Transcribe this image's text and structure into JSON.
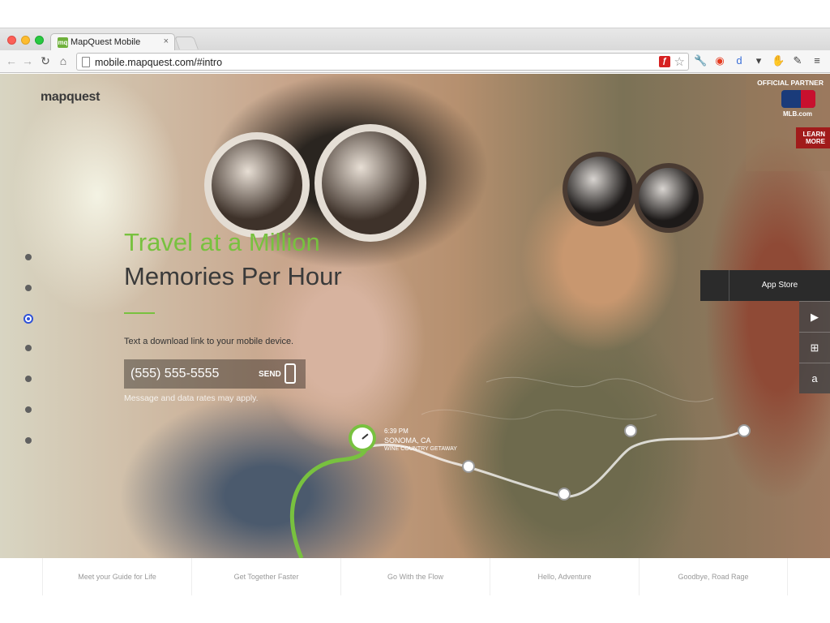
{
  "browser": {
    "tab_title": "MapQuest Mobile",
    "tab_favicon": "mq",
    "tab_close": "×",
    "url": "mobile.mapquest.com/#intro",
    "icons": [
      "back-icon",
      "forward-icon",
      "reload-icon",
      "home-icon",
      "flash-icon",
      "star-icon",
      "wrench-icon",
      "record-icon",
      "d-icon",
      "pocket-icon",
      "glove-icon",
      "tools-icon",
      "menu-icon"
    ]
  },
  "header": {
    "logo": "mapquest",
    "partner_label": "OFFICIAL PARTNER",
    "partner_logo": "MLB.com",
    "learn_more": "LEARN\nMORE"
  },
  "hero": {
    "headline_green": "Travel at a Million",
    "headline_dark": "Memories Per Hour",
    "prompt": "Text a download link to your mobile device.",
    "phone_value": "(555) 555-5555",
    "send_label": "SEND",
    "disclaimer": "Message and data rates may apply."
  },
  "pager": {
    "count": 7,
    "active_index": 2
  },
  "stores": {
    "app_store_label": "App Store",
    "items": [
      "apple-icon",
      "google-play-icon",
      "windows-icon",
      "amazon-icon"
    ]
  },
  "map_pin": {
    "time": "6:39 PM",
    "place": "SONOMA, CA",
    "subtitle": "WINE COUNTRY GETAWAY"
  },
  "footer_nav": [
    "Meet your Guide for Life",
    "Get Together Faster",
    "Go With the Flow",
    "Hello, Adventure",
    "Goodbye, Road Rage"
  ],
  "colors": {
    "accent_green": "#78c13f",
    "pager_active": "#2f52d8",
    "learn_more_red": "#a11b1b"
  }
}
